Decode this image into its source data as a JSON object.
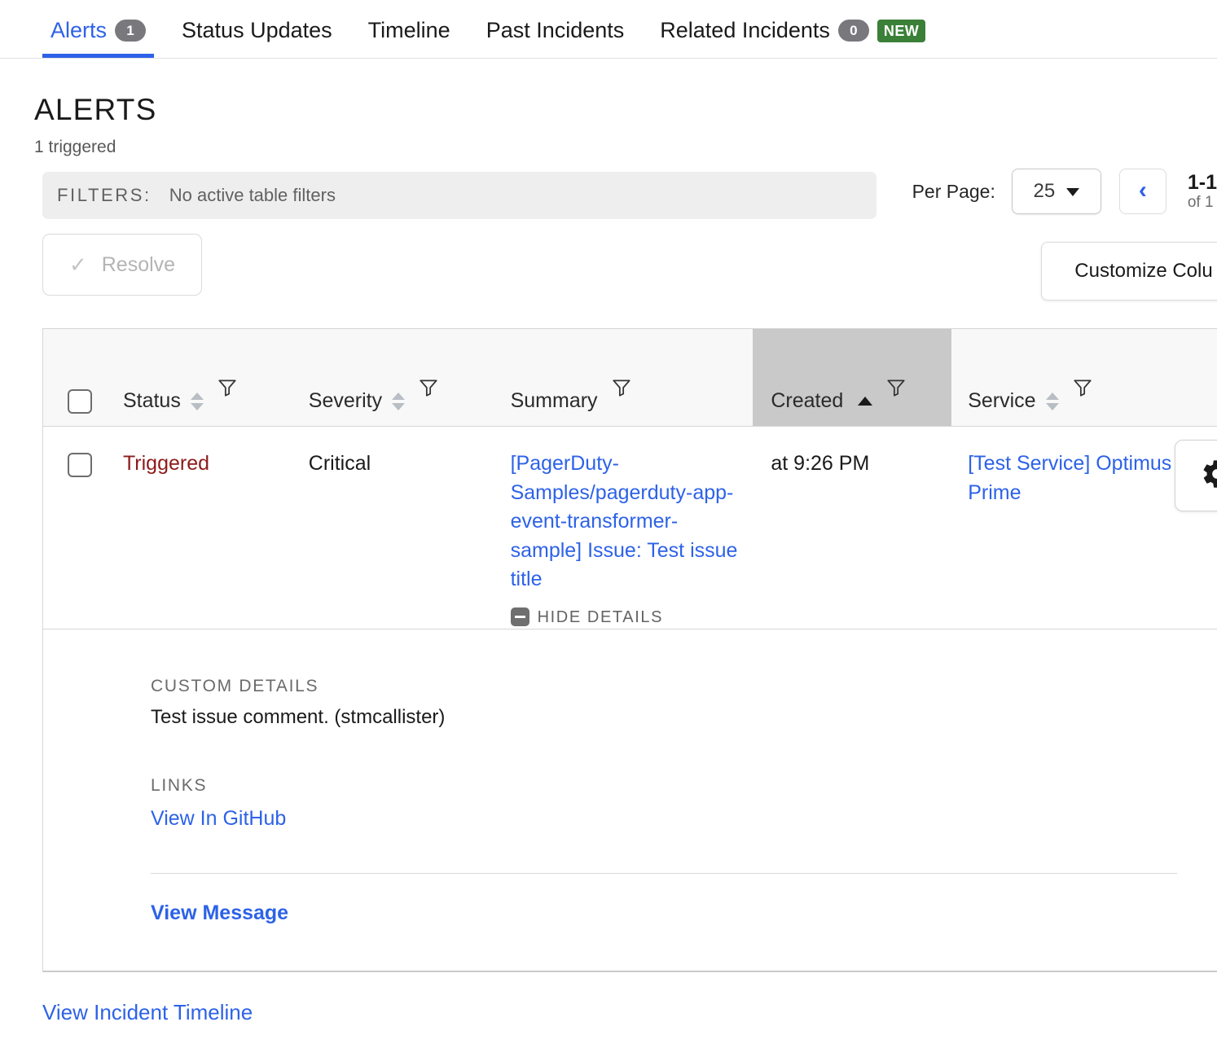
{
  "tabs": [
    {
      "label": "Alerts",
      "count": "1",
      "active": true,
      "badge": null
    },
    {
      "label": "Status Updates",
      "count": null,
      "active": false,
      "badge": null
    },
    {
      "label": "Timeline",
      "count": null,
      "active": false,
      "badge": null
    },
    {
      "label": "Past Incidents",
      "count": null,
      "active": false,
      "badge": null
    },
    {
      "label": "Related Incidents",
      "count": "0",
      "active": false,
      "badge": "NEW"
    }
  ],
  "page": {
    "title": "ALERTS",
    "subtitle": "1 triggered"
  },
  "filters": {
    "label": "FILTERS:",
    "value": "No active table filters"
  },
  "pagination": {
    "per_page_label": "Per Page:",
    "per_page_value": "25",
    "prev_icon": "chevron-left-icon",
    "range": "1-1",
    "total": "of 1"
  },
  "toolbar": {
    "resolve_label": "Resolve",
    "resolve_icon": "check-icon",
    "resolve_disabled": true,
    "customize_columns_label": "Customize Colu"
  },
  "table": {
    "columns": [
      {
        "label": "Status",
        "sortable": true,
        "filterable": true,
        "sorted": false
      },
      {
        "label": "Severity",
        "sortable": true,
        "filterable": true,
        "sorted": false
      },
      {
        "label": "Summary",
        "sortable": false,
        "filterable": true,
        "sorted": false
      },
      {
        "label": "Created",
        "sortable": true,
        "filterable": true,
        "sorted": true,
        "sort_dir": "asc"
      },
      {
        "label": "Service",
        "sortable": true,
        "filterable": true,
        "sorted": false
      }
    ],
    "rows": [
      {
        "status": "Triggered",
        "severity": "Critical",
        "summary": "[PagerDuty-Samples/pagerduty-app-event-transformer-sample] Issue: Test issue title",
        "details_toggle": "HIDE DETAILS",
        "created": "at 9:26 PM",
        "service": "[Test Service] Optimus Prime",
        "settings_icon": "gear-icon"
      }
    ]
  },
  "detail": {
    "custom_details_label": "CUSTOM DETAILS",
    "custom_details_text": "Test issue comment. (stmcallister)",
    "links_label": "LINKS",
    "link_text": "View In GitHub",
    "view_message_label": "View Message"
  },
  "footer": {
    "timeline_link": "View Incident Timeline"
  },
  "colors": {
    "accent_blue": "#2d62e8",
    "triggered_red": "#8e1a1a",
    "badge_gray": "#78787d",
    "new_green": "#3a8038",
    "sorted_header": "#c9c9c9"
  }
}
